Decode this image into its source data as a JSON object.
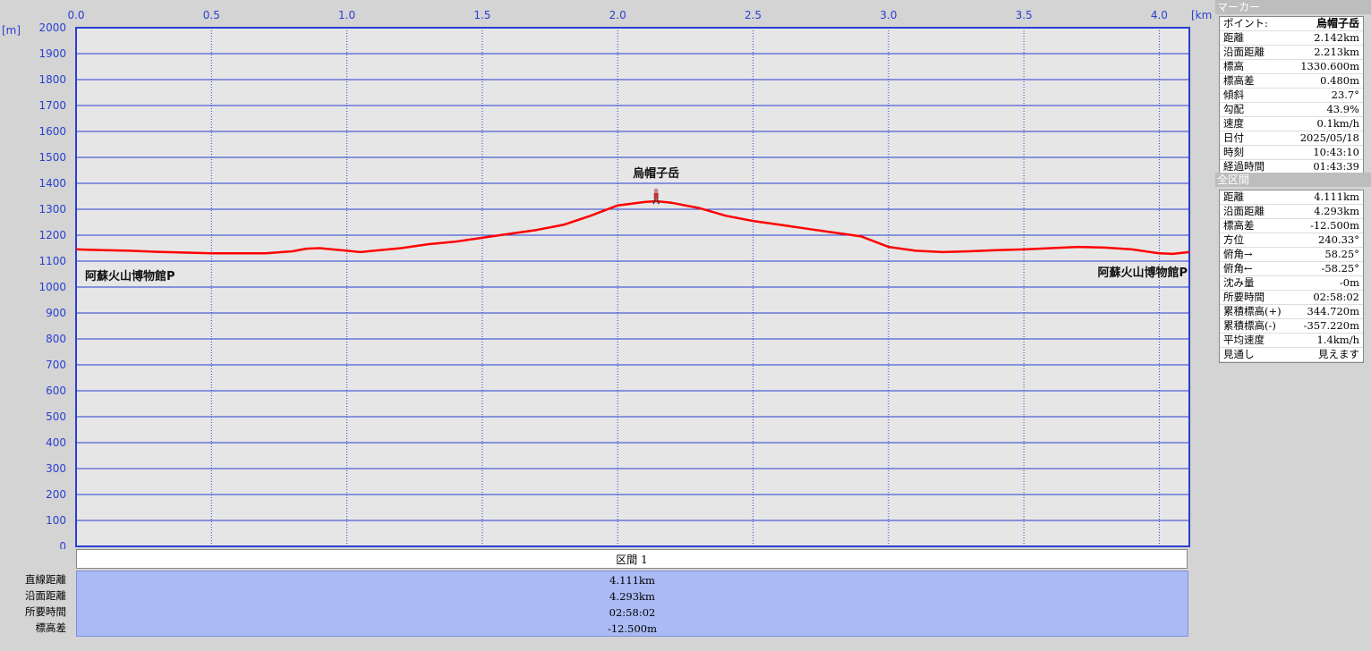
{
  "chart_data": {
    "type": "line",
    "x_unit_label": "[km]",
    "y_unit_label": "[m]",
    "xlim": [
      0,
      4.111
    ],
    "ylim": [
      0,
      2000
    ],
    "x_ticks": [
      "0.0",
      "0.5",
      "1.0",
      "1.5",
      "2.0",
      "2.5",
      "3.0",
      "3.5",
      "4.0"
    ],
    "y_ticks": [
      "2000",
      "1900",
      "1800",
      "1700",
      "1600",
      "1500",
      "1400",
      "1300",
      "1200",
      "1100",
      "1000",
      "900",
      "800",
      "700",
      "600",
      "500",
      "400",
      "300",
      "200",
      "100",
      "0"
    ],
    "grid": true,
    "series": [
      {
        "color": "#ff0000",
        "x": [
          0.0,
          0.1,
          0.2,
          0.3,
          0.5,
          0.7,
          0.8,
          0.85,
          0.9,
          1.0,
          1.05,
          1.1,
          1.2,
          1.3,
          1.4,
          1.5,
          1.6,
          1.7,
          1.8,
          1.9,
          2.0,
          2.1,
          2.142,
          2.2,
          2.3,
          2.4,
          2.5,
          2.6,
          2.7,
          2.8,
          2.9,
          3.0,
          3.1,
          3.2,
          3.3,
          3.4,
          3.5,
          3.6,
          3.7,
          3.8,
          3.9,
          4.0,
          4.05,
          4.111
        ],
        "y": [
          1145,
          1142,
          1140,
          1136,
          1130,
          1130,
          1138,
          1148,
          1150,
          1140,
          1135,
          1140,
          1150,
          1165,
          1175,
          1190,
          1205,
          1220,
          1240,
          1275,
          1315,
          1328,
          1331,
          1325,
          1305,
          1275,
          1255,
          1240,
          1225,
          1210,
          1195,
          1155,
          1140,
          1135,
          1138,
          1142,
          1145,
          1150,
          1155,
          1152,
          1145,
          1130,
          1128,
          1135
        ]
      }
    ],
    "annotations": [
      {
        "text": "烏帽子岳",
        "x": 2.142
      },
      {
        "text": "阿蘇火山博物館P",
        "x": 0.0
      },
      {
        "text": "阿蘇火山博物館P",
        "x": 4.111
      }
    ],
    "marker": {
      "x": 2.142,
      "y": 1330.6
    }
  },
  "section": {
    "header": "区間 1",
    "rows": [
      {
        "label": "直線距離",
        "value": "4.111km"
      },
      {
        "label": "沿面距離",
        "value": "4.293km"
      },
      {
        "label": "所要時間",
        "value": "02:58:02"
      },
      {
        "label": "標高差",
        "value": "-12.500m"
      }
    ]
  },
  "marker_panel": {
    "title": "マーカー",
    "rows": [
      {
        "label": "ポイント:",
        "value": "烏帽子岳"
      },
      {
        "label": "距離",
        "value": "2.142km"
      },
      {
        "label": "沿面距離",
        "value": "2.213km"
      },
      {
        "label": "標高",
        "value": "1330.600m"
      },
      {
        "label": "標高差",
        "value": "0.480m"
      },
      {
        "label": "傾斜",
        "value": "23.7°"
      },
      {
        "label": "勾配",
        "value": "43.9%"
      },
      {
        "label": "速度",
        "value": "0.1km/h"
      },
      {
        "label": "日付",
        "value": "2025/05/18"
      },
      {
        "label": "時刻",
        "value": "10:43:10"
      },
      {
        "label": "経過時間",
        "value": "01:43:39"
      }
    ]
  },
  "total_panel": {
    "title": "全区間",
    "rows": [
      {
        "label": "距離",
        "value": "4.111km"
      },
      {
        "label": "沿面距離",
        "value": "4.293km"
      },
      {
        "label": "標高差",
        "value": "-12.500m"
      },
      {
        "label": "方位",
        "value": "240.33°"
      },
      {
        "label": "俯角→",
        "value": "58.25°"
      },
      {
        "label": "俯角←",
        "value": "-58.25°"
      },
      {
        "label": "沈み量",
        "value": "-0m"
      },
      {
        "label": "所要時間",
        "value": "02:58:02"
      },
      {
        "label": "累積標高(+)",
        "value": "344.720m"
      },
      {
        "label": "累積標高(-)",
        "value": "-357.220m"
      },
      {
        "label": "平均速度",
        "value": "1.4km/h"
      },
      {
        "label": "見通し",
        "value": "見えます"
      }
    ]
  }
}
